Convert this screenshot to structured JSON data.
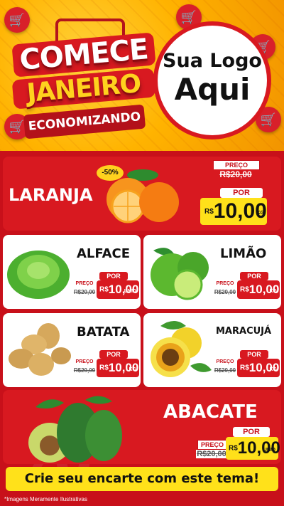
{
  "header": {
    "line1": "COMECE",
    "line2": "JANEIRO",
    "line3": "ECONOMIZANDO",
    "logo_line1": "Sua Logo",
    "logo_line2": "Aqui"
  },
  "products": [
    {
      "name": "LARANJA",
      "discount": "-50%",
      "preco_label": "PREÇO",
      "old_price": "R$20,00",
      "por_label": "POR",
      "currency": "R$",
      "price": "10,00",
      "unit": "KG",
      "icon": "orange-fruit"
    },
    {
      "name": "ALFACE",
      "preco_label": "PREÇO",
      "old_price": "R$20,00",
      "por_label": "POR",
      "currency": "R$",
      "price": "10,00",
      "unit": "UNID",
      "icon": "lettuce"
    },
    {
      "name": "LIMÃO",
      "preco_label": "PREÇO",
      "old_price": "R$20,00",
      "por_label": "POR",
      "currency": "R$",
      "price": "10,00",
      "unit": "KG",
      "icon": "lime"
    },
    {
      "name": "BATATA",
      "preco_label": "PREÇO",
      "old_price": "R$20,00",
      "por_label": "POR",
      "currency": "R$",
      "price": "10,00",
      "unit": "KG",
      "icon": "potato"
    },
    {
      "name": "MARACUJÁ",
      "preco_label": "PREÇO",
      "old_price": "R$20,00",
      "por_label": "POR",
      "currency": "R$",
      "price": "10,00",
      "unit": "KG",
      "icon": "passion-fruit"
    },
    {
      "name": "ABACATE",
      "preco_label": "PREÇO",
      "old_price": "R$20,00",
      "por_label": "POR",
      "currency": "R$",
      "price": "10,00",
      "unit": "UNID",
      "icon": "avocado"
    }
  ],
  "footer": {
    "cta": "Crie seu encarte com este tema!",
    "disclaimer": "*Imagens Meramente Ilustrativas"
  },
  "colors": {
    "red": "#d81920",
    "yellow": "#ffe11a",
    "orange_bg": "#ffb300"
  }
}
